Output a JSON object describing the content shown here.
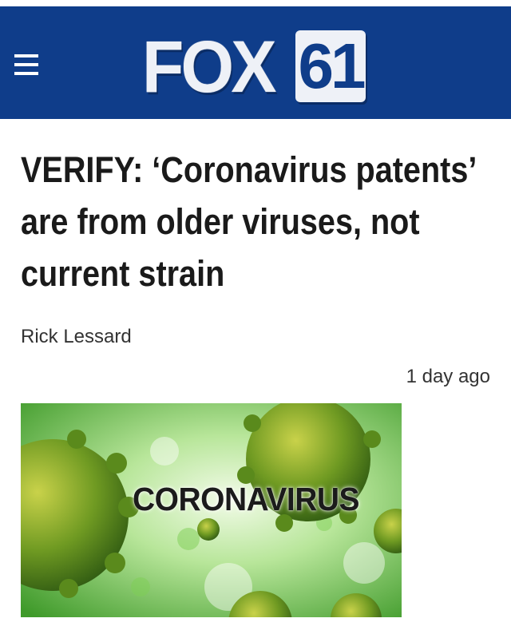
{
  "header": {
    "logo_text": "FOX",
    "logo_number": "61",
    "brand_color": "#0f3d8a"
  },
  "article": {
    "headline": "VERIFY: ‘Coronavirus patents’ are from older viruses, not current strain",
    "author": "Rick Lessard",
    "timestamp": "1 day ago",
    "image_caption": "CORONAVIRUS"
  },
  "icons": {
    "menu": "hamburger-menu-icon"
  }
}
